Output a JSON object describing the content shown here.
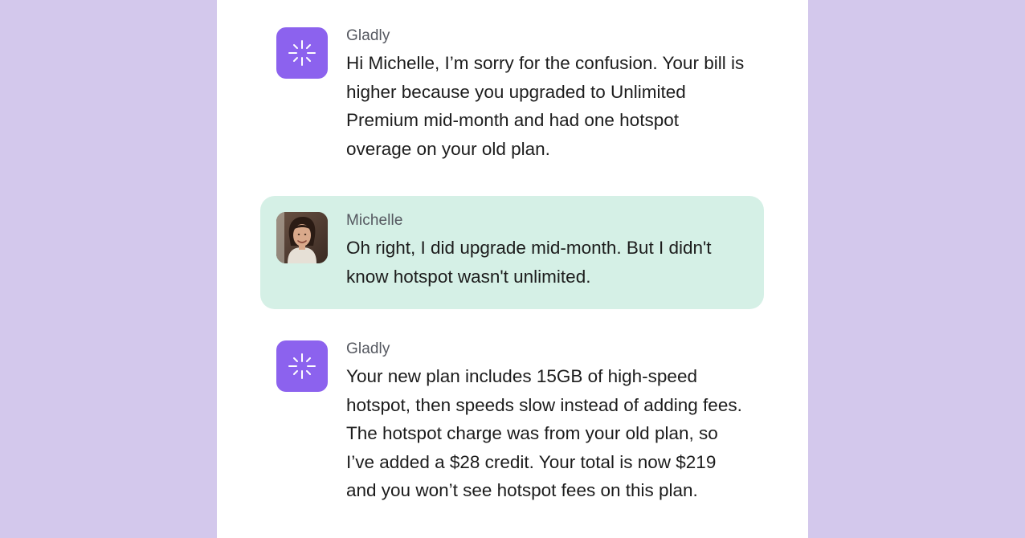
{
  "conversation": {
    "messages": [
      {
        "sender": "Gladly",
        "role": "agent",
        "avatar_icon": "sparkle-icon",
        "text": "Hi Michelle, I’m sorry for the confusion. Your bill is higher because you upgraded to Unlimited Premium mid-month and had one hotspot overage on your old plan."
      },
      {
        "sender": "Michelle",
        "role": "customer",
        "avatar_icon": "user-photo",
        "text": "Oh right, I did upgrade mid-month. But I didn't know hotspot wasn't unlimited."
      },
      {
        "sender": "Gladly",
        "role": "agent",
        "avatar_icon": "sparkle-icon",
        "text": "Your new plan includes 15GB of high-speed hotspot, then speeds slow instead of adding fees. The hotspot charge was from your old plan, so I’ve added a $28 credit. Your total is now $219 and you won’t see hotspot fees on this plan."
      }
    ]
  },
  "colors": {
    "page_background": "#d3c8ec",
    "panel_background": "#ffffff",
    "agent_avatar": "#8c62ee",
    "customer_highlight": "#d5f0e6"
  }
}
